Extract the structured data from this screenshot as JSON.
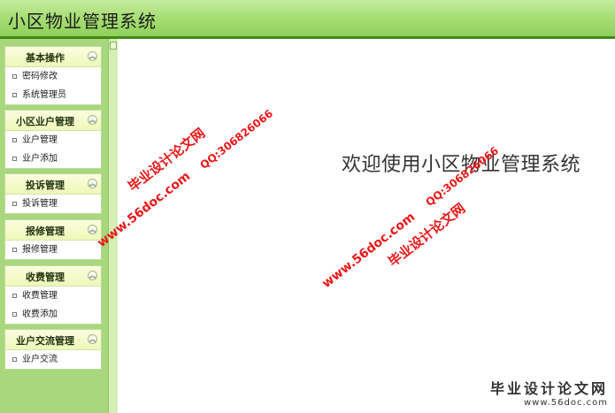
{
  "app": {
    "title": "小区物业管理系统"
  },
  "sidebar": {
    "groups": [
      {
        "title": "基本操作",
        "items": [
          "密码修改",
          "系统管理员"
        ]
      },
      {
        "title": "小区业户管理",
        "items": [
          "业户管理",
          "业户添加"
        ]
      },
      {
        "title": "投诉管理",
        "items": [
          "投诉管理"
        ]
      },
      {
        "title": "报修管理",
        "items": [
          "报修管理"
        ]
      },
      {
        "title": "收费管理",
        "items": [
          "收费管理",
          "收费添加"
        ]
      },
      {
        "title": "业户交流管理",
        "items": [
          "业户交流"
        ]
      }
    ]
  },
  "main": {
    "welcome": "欢迎使用小区物业管理系统"
  },
  "watermark": {
    "site": "毕业设计论文网",
    "url": "www.56doc.com",
    "qq": "QQ:306826066",
    "color": "#e81818"
  },
  "footer_brand": {
    "name": "毕业设计论文网",
    "url": "www.56doc.com"
  }
}
